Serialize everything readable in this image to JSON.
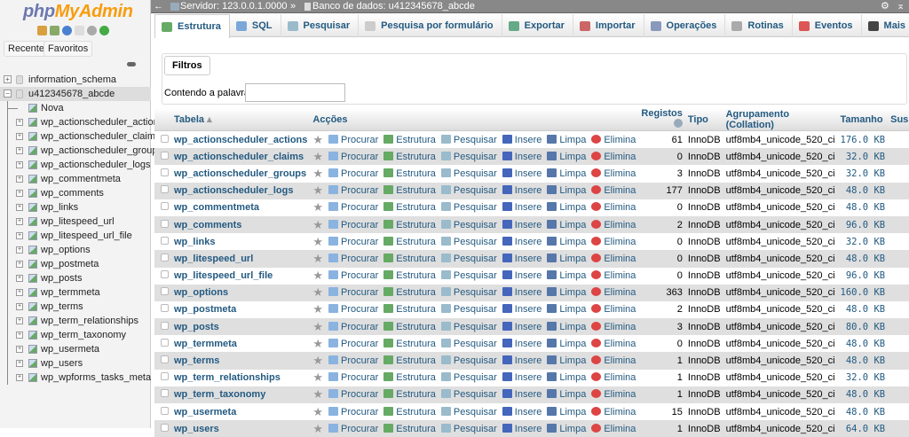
{
  "sidebar": {
    "logo_php": "php",
    "logo_rest": "MyAdmin",
    "recent": "Recente",
    "favorites": "Favoritos",
    "databases": [
      {
        "name": "information_schema"
      },
      {
        "name": "u412345678_abcde"
      }
    ],
    "new": "Nova",
    "tables": [
      "wp_actionscheduler_actions",
      "wp_actionscheduler_claims",
      "wp_actionscheduler_groups",
      "wp_actionscheduler_logs",
      "wp_commentmeta",
      "wp_comments",
      "wp_links",
      "wp_litespeed_url",
      "wp_litespeed_url_file",
      "wp_options",
      "wp_postmeta",
      "wp_posts",
      "wp_termmeta",
      "wp_terms",
      "wp_term_relationships",
      "wp_term_taxonomy",
      "wp_usermeta",
      "wp_users",
      "wp_wpforms_tasks_meta"
    ]
  },
  "breadcrumb": {
    "server": "Servidor: 123.0.0.1.0000",
    "sep": "»",
    "database": "Banco de dados: u412345678_abcde"
  },
  "tabs": [
    {
      "label": "Estrutura",
      "color": "#6a6"
    },
    {
      "label": "SQL",
      "color": "#7aa7d8"
    },
    {
      "label": "Pesquisar",
      "color": "#9bc"
    },
    {
      "label": "Pesquisa por formulário",
      "color": "#ccc"
    },
    {
      "label": "Exportar",
      "color": "#6a8"
    },
    {
      "label": "Importar",
      "color": "#c66"
    },
    {
      "label": "Operações",
      "color": "#89b"
    },
    {
      "label": "Rotinas",
      "color": "#aaa"
    },
    {
      "label": "Eventos",
      "color": "#d55"
    },
    {
      "label": "Mais",
      "color": "#444"
    }
  ],
  "filter": {
    "legend": "Filtros",
    "label": "Contendo a palavra:",
    "value": ""
  },
  "table": {
    "headers": {
      "table": "Tabela",
      "actions": "Acções",
      "rows": "Registos",
      "type": "Tipo",
      "collation": "Agrupamento (Collation)",
      "size": "Tamanho",
      "overhead": "Suspenso"
    },
    "actions": [
      "Procurar",
      "Estrutura",
      "Pesquisar",
      "Insere",
      "Limpa",
      "Elimina"
    ],
    "rows": [
      [
        "wp_actionscheduler_actions",
        "61",
        "InnoDB",
        "utf8mb4_unicode_520_ci",
        "176.0 KB",
        "–"
      ],
      [
        "wp_actionscheduler_claims",
        "0",
        "InnoDB",
        "utf8mb4_unicode_520_ci",
        "32.0 KB",
        "–"
      ],
      [
        "wp_actionscheduler_groups",
        "3",
        "InnoDB",
        "utf8mb4_unicode_520_ci",
        "32.0 KB",
        "–"
      ],
      [
        "wp_actionscheduler_logs",
        "177",
        "InnoDB",
        "utf8mb4_unicode_520_ci",
        "48.0 KB",
        "–"
      ],
      [
        "wp_commentmeta",
        "0",
        "InnoDB",
        "utf8mb4_unicode_520_ci",
        "48.0 KB",
        "–"
      ],
      [
        "wp_comments",
        "2",
        "InnoDB",
        "utf8mb4_unicode_520_ci",
        "96.0 KB",
        "–"
      ],
      [
        "wp_links",
        "0",
        "InnoDB",
        "utf8mb4_unicode_520_ci",
        "32.0 KB",
        "–"
      ],
      [
        "wp_litespeed_url",
        "0",
        "InnoDB",
        "utf8mb4_unicode_520_ci",
        "48.0 KB",
        "–"
      ],
      [
        "wp_litespeed_url_file",
        "0",
        "InnoDB",
        "utf8mb4_unicode_520_ci",
        "96.0 KB",
        "–"
      ],
      [
        "wp_options",
        "363",
        "InnoDB",
        "utf8mb4_unicode_520_ci",
        "160.0 KB",
        "–"
      ],
      [
        "wp_postmeta",
        "2",
        "InnoDB",
        "utf8mb4_unicode_520_ci",
        "48.0 KB",
        "–"
      ],
      [
        "wp_posts",
        "3",
        "InnoDB",
        "utf8mb4_unicode_520_ci",
        "80.0 KB",
        "–"
      ],
      [
        "wp_termmeta",
        "0",
        "InnoDB",
        "utf8mb4_unicode_520_ci",
        "48.0 KB",
        "–"
      ],
      [
        "wp_terms",
        "1",
        "InnoDB",
        "utf8mb4_unicode_520_ci",
        "48.0 KB",
        "–"
      ],
      [
        "wp_term_relationships",
        "1",
        "InnoDB",
        "utf8mb4_unicode_520_ci",
        "32.0 KB",
        "–"
      ],
      [
        "wp_term_taxonomy",
        "1",
        "InnoDB",
        "utf8mb4_unicode_520_ci",
        "48.0 KB",
        "–"
      ],
      [
        "wp_usermeta",
        "15",
        "InnoDB",
        "utf8mb4_unicode_520_ci",
        "48.0 KB",
        "–"
      ],
      [
        "wp_users",
        "1",
        "InnoDB",
        "utf8mb4_unicode_520_ci",
        "64.0 KB",
        "–"
      ]
    ]
  }
}
